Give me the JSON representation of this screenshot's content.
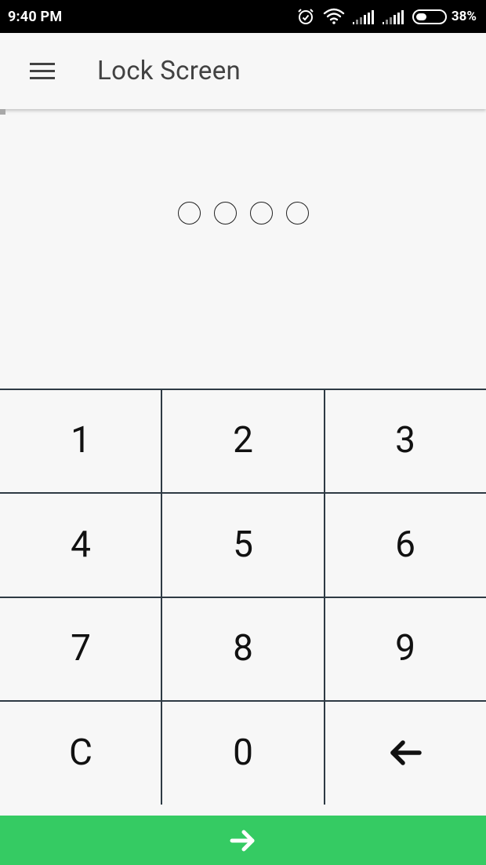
{
  "status_bar": {
    "time": "9:40 PM",
    "battery_percent_label": "38%",
    "battery_level": 0.38,
    "icons": [
      "alarm-icon",
      "wifi-icon",
      "signal-icon",
      "signal-icon",
      "battery-icon"
    ]
  },
  "app_bar": {
    "title": "Lock Screen",
    "menu_icon": "hamburger-menu-icon"
  },
  "pin": {
    "length": 4,
    "filled": 0
  },
  "keypad": {
    "keys": [
      {
        "label": "1",
        "type": "digit"
      },
      {
        "label": "2",
        "type": "digit"
      },
      {
        "label": "3",
        "type": "digit"
      },
      {
        "label": "4",
        "type": "digit"
      },
      {
        "label": "5",
        "type": "digit"
      },
      {
        "label": "6",
        "type": "digit"
      },
      {
        "label": "7",
        "type": "digit"
      },
      {
        "label": "8",
        "type": "digit"
      },
      {
        "label": "9",
        "type": "digit"
      },
      {
        "label": "C",
        "type": "clear"
      },
      {
        "label": "0",
        "type": "digit"
      },
      {
        "label": "",
        "type": "backspace",
        "icon": "arrow-left-icon"
      }
    ]
  },
  "submit": {
    "icon": "arrow-right-icon"
  },
  "colors": {
    "background": "#f7f7f7",
    "status_bar": "#000000",
    "title_text": "#424242",
    "grid_lines": "#2e3a44",
    "submit_bar": "#35cb63",
    "submit_icon": "#ffffff"
  }
}
